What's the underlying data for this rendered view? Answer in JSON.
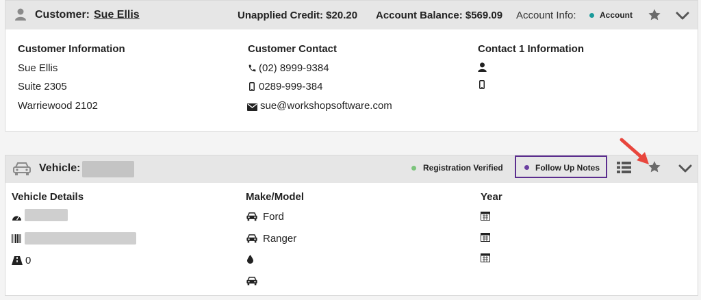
{
  "customer": {
    "label": "Customer:",
    "name": "Sue Ellis",
    "unapplied_credit": "Unapplied Credit: $20.20",
    "account_balance": "Account Balance: $569.09",
    "account_info_label": "Account Info:",
    "account_badge": "Account",
    "sections": {
      "info_title": "Customer Information",
      "contact_title": "Customer Contact",
      "contact1_title": "Contact 1 Information"
    },
    "info": [
      "Sue Ellis",
      "Suite 2305",
      "Warriewood 2102"
    ],
    "contact": {
      "phone": "(02) 8999-9384",
      "mobile": "0289-999-384",
      "email": "sue@workshopsoftware.com"
    }
  },
  "vehicle": {
    "label": "Vehicle:",
    "registration_badge": "Registration Verified",
    "follow_up": "Follow Up Notes",
    "sections": {
      "details_title": "Vehicle Details",
      "make_model_title": "Make/Model",
      "year_title": "Year"
    },
    "odometer": "0",
    "make": "Ford",
    "model": "Ranger"
  },
  "colors": {
    "account_dot": "#1a9a9a",
    "registration_dot": "#7cc47c",
    "follow_up_dot": "#6a3fa0",
    "follow_up_border": "#5b2d8e",
    "arrow": "#e8463d",
    "icon_gray": "#6b6b6b"
  }
}
